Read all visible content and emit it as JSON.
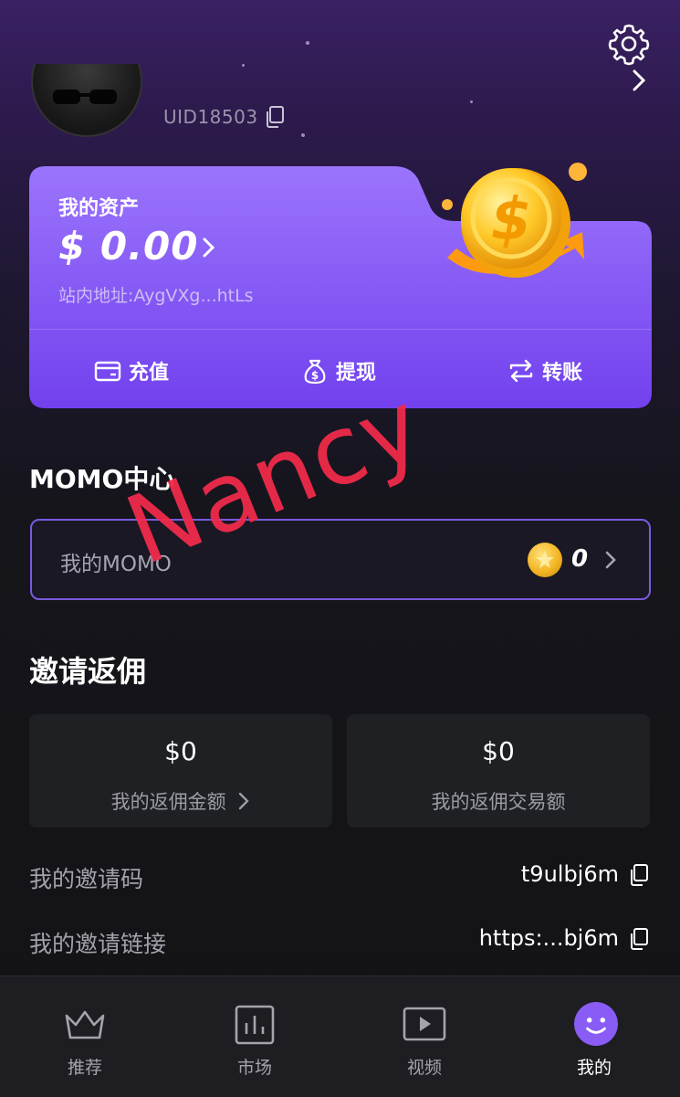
{
  "profile": {
    "uid": "UID18503"
  },
  "asset_card": {
    "title": "我的资产",
    "amount": "$ 0.00",
    "address": "站内地址:AygVXg...htLs",
    "actions": [
      {
        "label": "充值",
        "icon": "card-icon"
      },
      {
        "label": "提现",
        "icon": "money-bag-icon"
      },
      {
        "label": "转账",
        "icon": "transfer-icon"
      }
    ]
  },
  "momo": {
    "section_title": "MOMO中心",
    "label": "我的MOMO",
    "value": "0"
  },
  "watermark": "Nancy",
  "rebate": {
    "section_title": "邀请返佣",
    "cards": [
      {
        "value": "$0",
        "label": "我的返佣金额"
      },
      {
        "value": "$0",
        "label": "我的返佣交易额"
      }
    ],
    "invite_code_label": "我的邀请码",
    "invite_code": "t9ulbj6m",
    "invite_link_label": "我的邀请链接",
    "invite_link": "https:...bj6m"
  },
  "nav": {
    "items": [
      {
        "label": "推荐",
        "icon": "crown-icon",
        "active": false
      },
      {
        "label": "市场",
        "icon": "chart-icon",
        "active": false
      },
      {
        "label": "视频",
        "icon": "play-icon",
        "active": false
      },
      {
        "label": "我的",
        "icon": "smiley-icon",
        "active": true
      }
    ]
  },
  "colors": {
    "accent": "#8b5cf6",
    "card_top": "#9a72fb",
    "card_bottom": "#7543ef",
    "watermark": "#ef2b4a",
    "background": "#15151b"
  }
}
